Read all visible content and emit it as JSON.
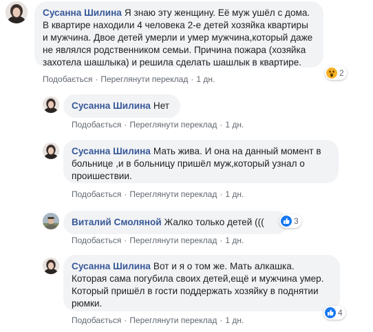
{
  "comments": [
    {
      "author": "Сусанна Шилина",
      "text": "Я знаю эту женщину. Её муж ушёл с дома. В квартире находили 4 человека 2-е детей хозяйка квартиры и мужчина. Двое детей умерли и умер мужчина,который даже не являлся родственником семьи. Причина пожара (хозяйка захотела шашлыка) и решила сделать шашлык в квартире.",
      "like": "Подобається",
      "translate": "Переглянути переклад",
      "time": "1 дн.",
      "reaction_count": "2",
      "reaction_icon": "wow-icon"
    },
    {
      "author": "Сусанна Шилина",
      "text": "Нет",
      "like": "Подобається",
      "translate": "Переглянути переклад",
      "time": "1 дн."
    },
    {
      "author": "Сусанна Шилина",
      "text": "Мать жива. И она на данный момент в больнице ,и в больницу пришёл муж,который узнал о проишествии.",
      "like": "Подобається",
      "translate": "Переглянути переклад",
      "time": "1 дн."
    },
    {
      "author": "Виталий Смоляной",
      "text": "Жалко только детей (((",
      "like": "Подобається",
      "translate": "Переглянути переклад",
      "time": "1 дн.",
      "reaction_count": "3",
      "reaction_icon": "like-icon"
    },
    {
      "author": "Сусанна Шилина",
      "text": "Вот и я о том же. Мать алкашка. Которая сама погубила своих детей,ещё и мужчина умер. Который пришёл в гости поддержать хозяйку в поднятии рюмки.",
      "like": "Подобається",
      "translate": "Переглянути переклад",
      "time": "1 дн.",
      "reaction_count": "4",
      "reaction_icon": "like-icon"
    }
  ],
  "colors": {
    "bubble": "#f2f3f5",
    "author": "#385898",
    "meta": "#606770",
    "like_blue": "#1877f2",
    "wow_yellow": "#f7b125"
  }
}
